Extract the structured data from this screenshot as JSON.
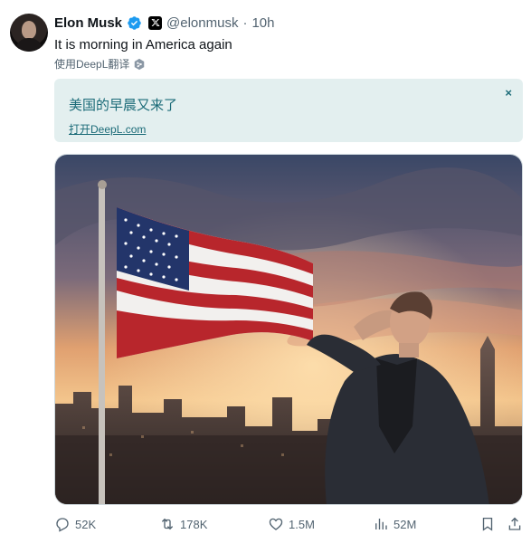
{
  "tweet": {
    "author_name": "Elon Musk",
    "handle": "@elonmusk",
    "separator": "·",
    "time": "10h",
    "text": "It is morning in America again",
    "translate_label": "使用DeepL翻译",
    "icons": {
      "verified": "verified-badge-icon",
      "affiliation": "x-logo-icon",
      "translate": "deepl-icon"
    }
  },
  "translation": {
    "text": "美国的早晨又来了",
    "open_link": "打开DeepL.com",
    "close_glyph": "×",
    "colors": {
      "background": "#e3efef",
      "text": "#1b6b78"
    }
  },
  "media": {
    "icon": "photo-flag-salute"
  },
  "actions": {
    "replies": "52K",
    "reposts": "178K",
    "likes": "1.5M",
    "views": "52M"
  },
  "colors": {
    "verified": "#1d9bf0",
    "muted": "#536471"
  }
}
